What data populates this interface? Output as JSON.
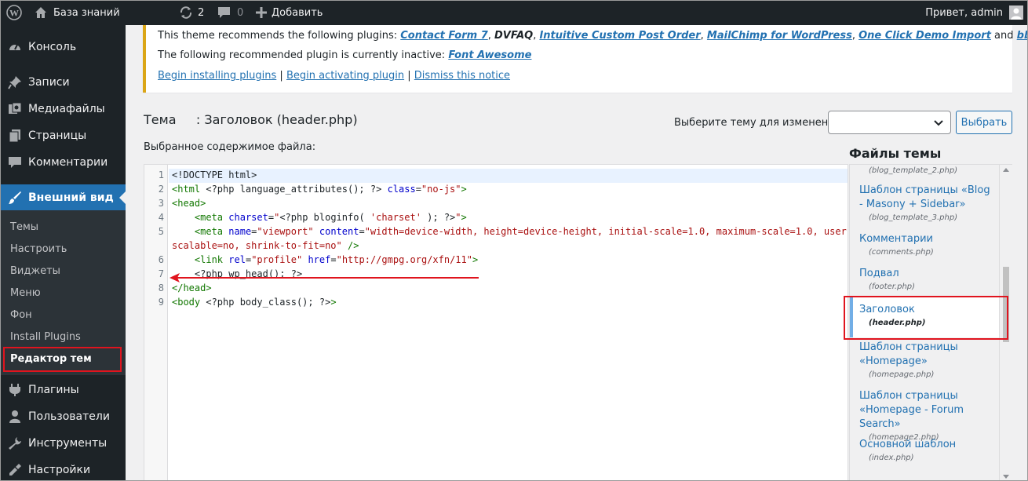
{
  "adminbar": {
    "site_name": "База знаний",
    "updates_count": "2",
    "comments_count": "0",
    "new_label": "Добавить",
    "greeting": "Привет, admin"
  },
  "sidebar": {
    "items": [
      {
        "label": "Консоль",
        "icon": "dashboard-icon"
      },
      {
        "label": "Записи",
        "icon": "pin-icon"
      },
      {
        "label": "Медиафайлы",
        "icon": "media-icon"
      },
      {
        "label": "Страницы",
        "icon": "page-icon"
      },
      {
        "label": "Комментарии",
        "icon": "comment-icon"
      },
      {
        "label": "Внешний вид",
        "icon": "brush-icon"
      },
      {
        "label": "Плагины",
        "icon": "plugin-icon"
      },
      {
        "label": "Пользователи",
        "icon": "users-icon"
      },
      {
        "label": "Инструменты",
        "icon": "tools-icon"
      },
      {
        "label": "Настройки",
        "icon": "settings-icon"
      }
    ],
    "submenu": [
      "Темы",
      "Настроить",
      "Виджеты",
      "Меню",
      "Фон",
      "Install Plugins",
      "Редактор тем"
    ]
  },
  "notice": {
    "line1_prefix": "This theme recommends the following plugins: ",
    "plugins": [
      "Contact Form 7",
      "DVFAQ",
      "Intuitive Custom Post Order",
      "MailChimp for WordPress",
      "One Click Demo Import",
      "bbPress"
    ],
    "and": " and ",
    "line2_prefix": "The following recommended plugin is currently inactive: ",
    "inactive_plugin": "Font Awesome",
    "links": [
      "Begin installing plugins",
      "Begin activating plugin",
      "Dismiss this notice"
    ]
  },
  "editor": {
    "title": "Тема     : Заголовок (header.php)",
    "select_label": "Выберите тему для изменения:",
    "select_value": "",
    "select_button": "Выбрать",
    "file_label": "Выбранное содержимое файла:",
    "line_numbers": [
      "1",
      "2",
      "3",
      "4",
      "5",
      "",
      "6",
      "7",
      "8",
      "9"
    ]
  },
  "files": {
    "title": "Файлы темы",
    "entries": [
      {
        "name": "",
        "path": "(blog_template_2.php)"
      },
      {
        "name": "Шаблон страницы «Blog - Masony + Sidebar»",
        "path": "(blog_template_3.php)"
      },
      {
        "name": "Комментарии",
        "path": "(comments.php)"
      },
      {
        "name": "Подвал",
        "path": "(footer.php)"
      },
      {
        "name": "Заголовок",
        "path": "(header.php)"
      },
      {
        "name": "Шаблон страницы «Homepage»",
        "path": "(homepage.php)"
      },
      {
        "name": "Шаблон страницы «Homepage - Forum Search»",
        "path": "(homepage2.php)"
      },
      {
        "name": "Основной шаблон",
        "path": "(index.php)"
      }
    ]
  },
  "colors": {
    "accent": "#2271b1",
    "admin_bg": "#1d2327",
    "notice_border": "#dba617",
    "highlight_red": "#e0141e"
  }
}
